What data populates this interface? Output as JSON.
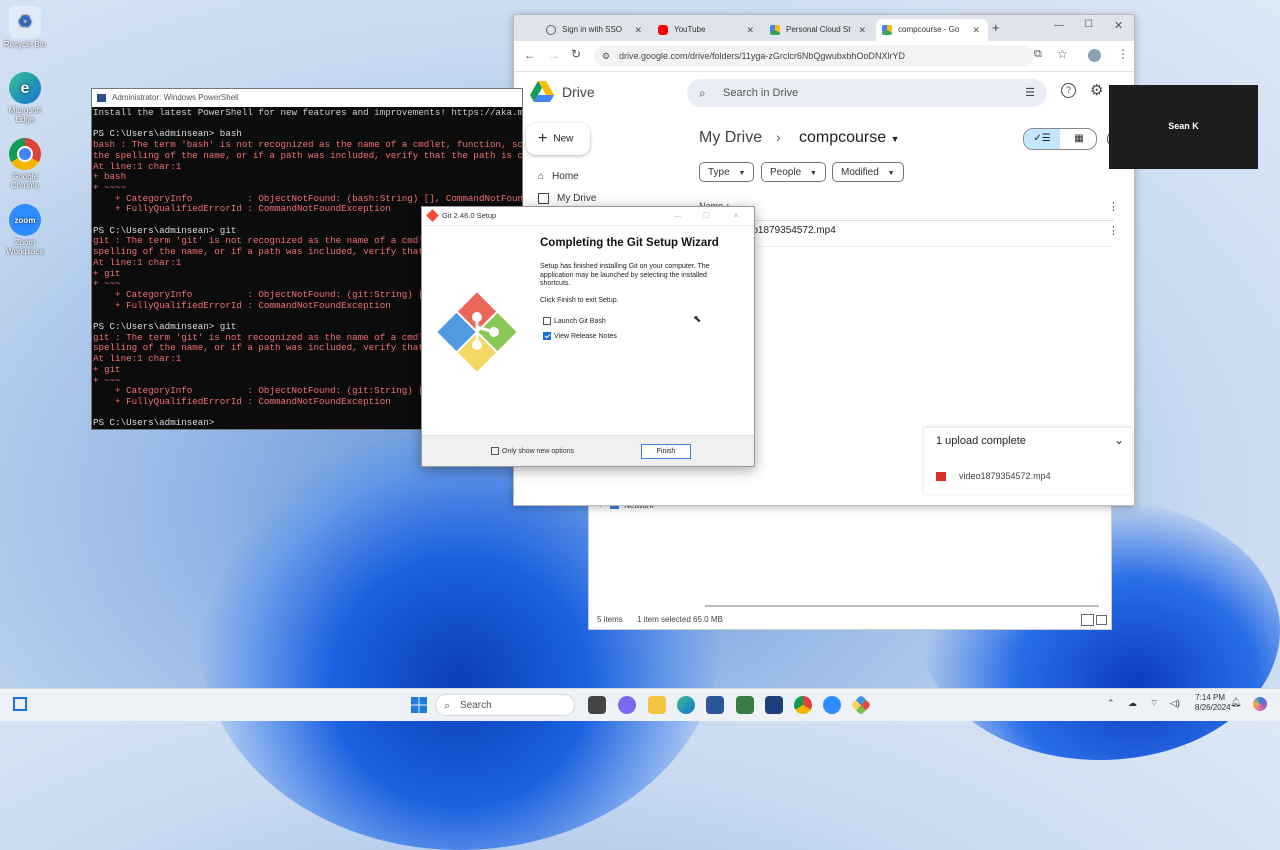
{
  "desktop": {
    "icons": [
      {
        "label": "Recycle Bin"
      },
      {
        "label": "Microsoft Edge"
      },
      {
        "label": "Google Chrome"
      },
      {
        "label": "Zoom Workplace"
      }
    ]
  },
  "powershell": {
    "title": "Administrator: Windows PowerShell",
    "lines": [
      {
        "text": "Install the latest PowerShell for new features and improvements! https://aka.ms",
        "kind": "normal"
      },
      {
        "text": "",
        "kind": "normal"
      },
      {
        "text": "PS C:\\Users\\adminsean> bash",
        "kind": "prompt"
      },
      {
        "text": "bash : The term 'bash' is not recognized as the name of a cmdlet, function, scr",
        "kind": "err"
      },
      {
        "text": "the spelling of the name, or if a path was included, verify that the path is co",
        "kind": "err"
      },
      {
        "text": "At line:1 char:1",
        "kind": "err"
      },
      {
        "text": "+ bash",
        "kind": "err"
      },
      {
        "text": "+ ~~~~",
        "kind": "err"
      },
      {
        "text": "    + CategoryInfo          : ObjectNotFound: (bash:String) [], CommandNotFoun",
        "kind": "err"
      },
      {
        "text": "    + FullyQualifiedErrorId : CommandNotFoundException",
        "kind": "err"
      },
      {
        "text": "",
        "kind": "normal"
      },
      {
        "text": "PS C:\\Users\\adminsean> git",
        "kind": "prompt"
      },
      {
        "text": "git : The term 'git' is not recognized as the name of a cmdlet",
        "kind": "err"
      },
      {
        "text": "spelling of the name, or if a path was included, verify that t",
        "kind": "err"
      },
      {
        "text": "At line:1 char:1",
        "kind": "err"
      },
      {
        "text": "+ git",
        "kind": "err"
      },
      {
        "text": "+ ~~~",
        "kind": "err"
      },
      {
        "text": "    + CategoryInfo          : ObjectNotFound: (git:String) [],",
        "kind": "err"
      },
      {
        "text": "    + FullyQualifiedErrorId : CommandNotFoundException",
        "kind": "err"
      },
      {
        "text": "",
        "kind": "normal"
      },
      {
        "text": "PS C:\\Users\\adminsean> git",
        "kind": "prompt"
      },
      {
        "text": "git : The term 'git' is not recognized as the name of a cmdlet",
        "kind": "err"
      },
      {
        "text": "spelling of the name, or if a path was included, verify that t",
        "kind": "err"
      },
      {
        "text": "At line:1 char:1",
        "kind": "err"
      },
      {
        "text": "+ git",
        "kind": "err"
      },
      {
        "text": "+ ~~~",
        "kind": "err"
      },
      {
        "text": "    + CategoryInfo          : ObjectNotFound: (git:String) [],",
        "kind": "err"
      },
      {
        "text": "    + FullyQualifiedErrorId : CommandNotFoundException",
        "kind": "err"
      },
      {
        "text": "",
        "kind": "normal"
      },
      {
        "text": "PS C:\\Users\\adminsean>",
        "kind": "prompt"
      }
    ]
  },
  "chrome": {
    "tabs": [
      {
        "label": "Sign in with SSO",
        "icon_color": "#5f6368"
      },
      {
        "label": "YouTube",
        "icon_color": "#ff0000"
      },
      {
        "label": "Personal Cloud St",
        "icon_color": "#1fa463"
      },
      {
        "label": "compcourse - Go",
        "icon_color": "#1fa463"
      }
    ],
    "url": "drive.google.com/drive/folders/11yga-zGrclcr6NbQgwubxbhOoDNXlrYD",
    "drive": {
      "brand": "Drive",
      "search_placeholder": "Search in Drive",
      "new_label": "New",
      "nav": [
        {
          "label": "Home"
        },
        {
          "label": "My Drive"
        }
      ],
      "breadcrumb_root": "My Drive",
      "breadcrumb_current": "compcourse",
      "filters": [
        {
          "label": "Type"
        },
        {
          "label": "People"
        },
        {
          "label": "Modified"
        }
      ],
      "column_name": "Name",
      "file_name": "video1879354572.mp4"
    }
  },
  "upload": {
    "title": "1 upload complete",
    "file": "video1879354572.mp4"
  },
  "explorer": {
    "network_label": "Network",
    "status_items": "5 items",
    "status_selected": "1 item selected  65.0 MB"
  },
  "git_setup": {
    "title": "Git 2.46.0 Setup",
    "heading": "Completing the Git Setup Wizard",
    "body1": "Setup has finished installing Git on your computer. The application may be launched by selecting the installed shortcuts.",
    "body2": "Click Finish to exit Setup.",
    "opt_launch": "Launch Git Bash",
    "opt_launch_checked": false,
    "opt_notes": "View Release Notes",
    "opt_notes_checked": true,
    "only_new": "Only show new options",
    "finish": "Finish"
  },
  "video_tile": {
    "name": "Sean K"
  },
  "taskbar": {
    "search_placeholder": "Search",
    "time": "7:14 PM",
    "date": "8/26/2024"
  }
}
